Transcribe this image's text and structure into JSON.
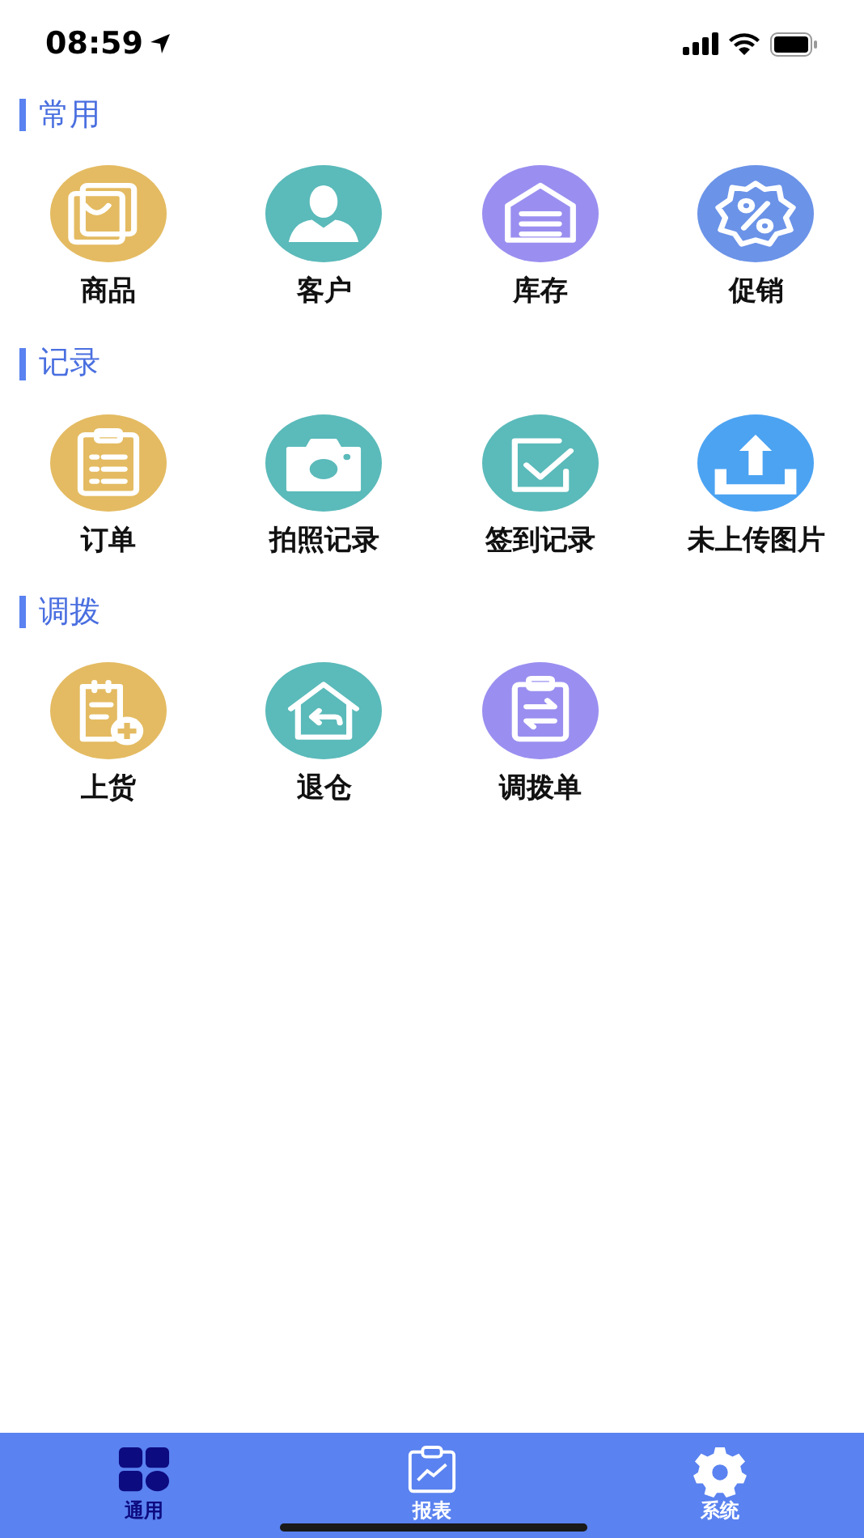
{
  "status_bar": {
    "time": "08:59"
  },
  "sections": [
    {
      "title": "常用",
      "items": [
        {
          "label": "商品",
          "kind": "bag",
          "color": "#e4bb62"
        },
        {
          "label": "客户",
          "kind": "person",
          "color": "#5bbaba"
        },
        {
          "label": "库存",
          "kind": "warehouse",
          "color": "#9a8ff0"
        },
        {
          "label": "促销",
          "kind": "discount",
          "color": "#6b93e8"
        }
      ]
    },
    {
      "title": "记录",
      "items": [
        {
          "label": "订单",
          "kind": "clipboard",
          "color": "#e4bb62"
        },
        {
          "label": "拍照记录",
          "kind": "camera",
          "color": "#5bbaba"
        },
        {
          "label": "签到记录",
          "kind": "check",
          "color": "#5bbaba"
        },
        {
          "label": "未上传图片",
          "kind": "upload",
          "color": "#4ca3f2"
        }
      ]
    },
    {
      "title": "调拨",
      "items": [
        {
          "label": "上货",
          "kind": "add-list",
          "color": "#e4bb62"
        },
        {
          "label": "退仓",
          "kind": "return-home",
          "color": "#5bbaba"
        },
        {
          "label": "调拨单",
          "kind": "transfer",
          "color": "#9a8ff0"
        }
      ]
    }
  ],
  "tab_bar": [
    {
      "label": "通用",
      "kind": "grid",
      "selected": true
    },
    {
      "label": "报表",
      "kind": "report",
      "selected": false
    },
    {
      "label": "系统",
      "kind": "gear",
      "selected": false
    }
  ]
}
